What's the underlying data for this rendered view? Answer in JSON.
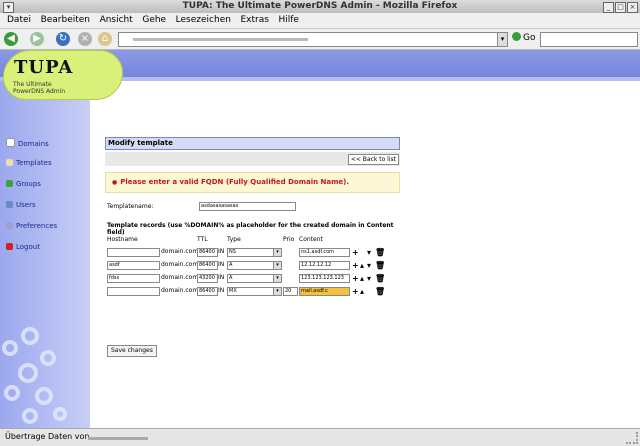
{
  "window": {
    "title": "TUPA: The Ultimate PowerDNS Admin - Mozilla Firefox"
  },
  "menu": [
    "Datei",
    "Bearbeiten",
    "Ansicht",
    "Gehe",
    "Lesezeichen",
    "Extras",
    "Hilfe"
  ],
  "toolbar": {
    "go_label": "Go"
  },
  "logo": {
    "word": "TUPA",
    "sub_line1": "The Ultimate",
    "sub_line2": "PowerDNS Admin"
  },
  "sidebar": {
    "items": [
      {
        "label": "Domains",
        "icon": "domains-icon",
        "color": "#ffffff"
      },
      {
        "label": "Templates",
        "icon": "templates-icon",
        "color": "#e8e0b0"
      },
      {
        "label": "Groups",
        "icon": "groups-icon",
        "color": "#40a040"
      },
      {
        "label": "Users",
        "icon": "users-icon",
        "color": "#6a8ad0"
      },
      {
        "label": "Preferences",
        "icon": "preferences-icon",
        "color": "#a0a0d0"
      },
      {
        "label": "Logout",
        "icon": "logout-icon",
        "color": "#d02020"
      }
    ]
  },
  "panel": {
    "title": "Modify template",
    "back_label": "<< Back to list",
    "error": "Please enter a valid FQDN (Fully Qualified Domain Name).",
    "template_name_label": "Templatename:",
    "template_name_value": "asdasasasasas",
    "records_title": "Template records (use %DOMAIN% as placeholder for the created domain in Content field)",
    "columns": {
      "hostname": "Hostname",
      "ttl": "TTL",
      "type": "Type",
      "prio": "Prio",
      "content": "Content"
    },
    "domain_suffix": "domain.com",
    "in_label": "IN",
    "records": [
      {
        "hostname": "",
        "ttl": "86400",
        "type": "NS",
        "prio": "",
        "content": "ns1.asdf.com"
      },
      {
        "hostname": "asdf",
        "ttl": "86400",
        "type": "A",
        "prio": "",
        "content": "12.12.12.12"
      },
      {
        "hostname": "fdss",
        "ttl": "43200",
        "type": "A",
        "prio": "",
        "content": "123.123.123.123"
      },
      {
        "hostname": "",
        "ttl": "86400",
        "type": "MX",
        "prio": "20",
        "content": "mail.asdf.c"
      }
    ],
    "save_label": "Save changes"
  },
  "status": {
    "text": "Übertrage Daten von"
  },
  "colors": {
    "header": "#8c99e6",
    "logo": "#d9f07a",
    "error": "#c21a1a"
  }
}
